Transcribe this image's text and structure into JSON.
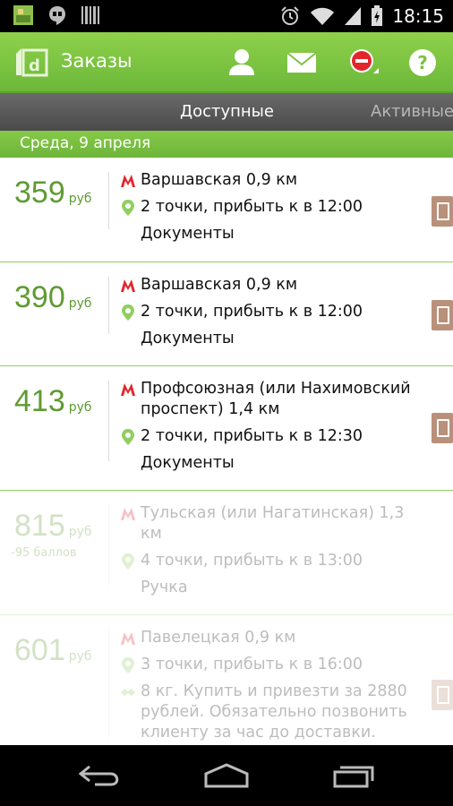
{
  "status_bar": {
    "time": "18:15"
  },
  "action_bar": {
    "title": "Заказы"
  },
  "tabs": {
    "active": "Доступные",
    "next": "Активные"
  },
  "date_header": "Среда, 9 апреля",
  "orders": [
    {
      "price": "359",
      "unit": "руб",
      "metro": "Варшавская 0,9 км",
      "points": "2 точки, прибыть к в 12:00",
      "cargo": "Документы"
    },
    {
      "price": "390",
      "unit": "руб",
      "metro": "Варшавская 0,9 км",
      "points": "2 точки, прибыть к в 12:00",
      "cargo": "Документы"
    },
    {
      "price": "413",
      "unit": "руб",
      "metro": "Профсоюзная (или Нахимовский проспект) 1,4 км",
      "points": "2 точки, прибыть к в 12:30",
      "cargo": "Документы"
    },
    {
      "price": "815",
      "unit": "руб",
      "bonus": "-95 баллов",
      "metro": "Тульская (или Нагатинская) 1,3 км",
      "points": "4 точки, прибыть к в 13:00",
      "cargo": "Ручка"
    },
    {
      "price": "601",
      "unit": "руб",
      "metro": "Павелецкая 0,9 км",
      "points": "3 точки, прибыть к в 16:00",
      "cargo": "8 кг. Купить и привезти за 2880 рублей. Обязательно позвонить клиенту за час до доставки."
    }
  ],
  "colors": {
    "accent": "#7cc242",
    "price": "#5e9b32",
    "metro": "#e3262c",
    "pin": "#8fcf60",
    "side_icon": "#b9907a"
  }
}
